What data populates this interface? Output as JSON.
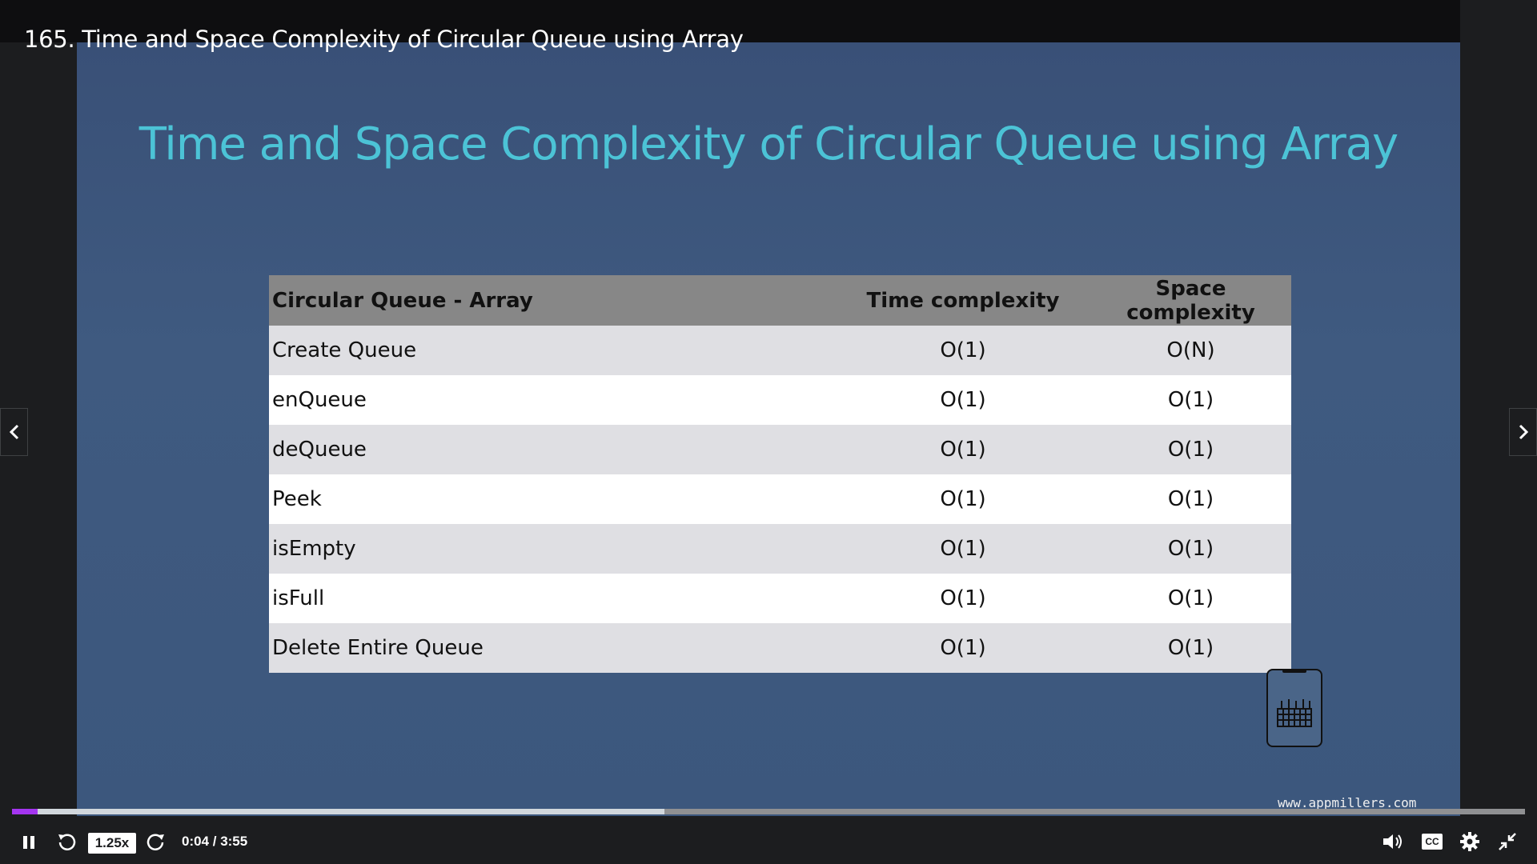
{
  "video": {
    "title": "165. Time and Space Complexity of Circular Queue using Array"
  },
  "slide": {
    "title": "Time and Space Complexity of Circular Queue using Array",
    "table": {
      "headers": [
        "Circular Queue - Array",
        "Time complexity",
        "Space complexity"
      ],
      "rows": [
        [
          "Create Queue",
          "O(1)",
          "O(N)"
        ],
        [
          "enQueue",
          "O(1)",
          "O(1)"
        ],
        [
          "deQueue",
          "O(1)",
          "O(1)"
        ],
        [
          "Peek",
          "O(1)",
          "O(1)"
        ],
        [
          "isEmpty",
          "O(1)",
          "O(1)"
        ],
        [
          "isFull",
          "O(1)",
          "O(1)"
        ],
        [
          "Delete Entire Queue",
          "O(1)",
          "O(1)"
        ]
      ]
    },
    "watermark_url": "www.appmillers.com"
  },
  "player": {
    "speed": "1.25x",
    "time": "0:04 / 3:55",
    "progress_played": 0.017,
    "progress_buffered": 0.431,
    "cc_label": "CC",
    "accent_color": "#a435f0"
  }
}
